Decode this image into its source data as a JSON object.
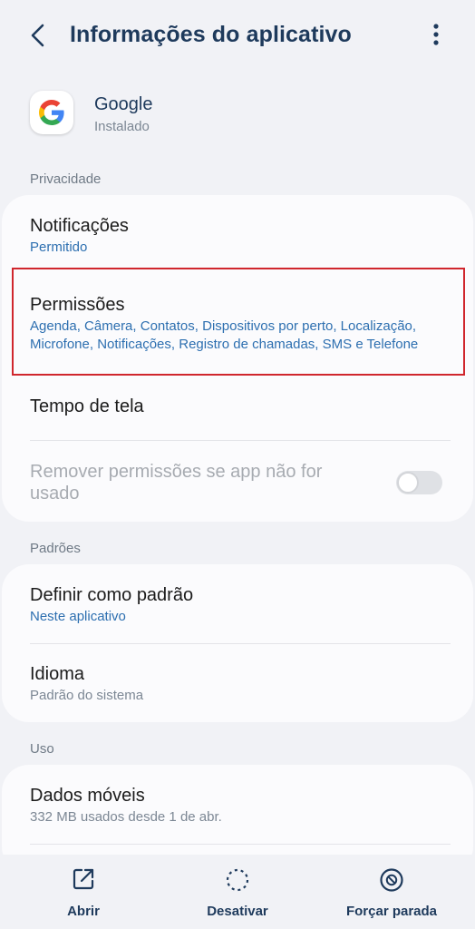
{
  "header": {
    "title": "Informações do aplicativo"
  },
  "app": {
    "name": "Google",
    "status": "Instalado"
  },
  "sections": {
    "privacy": "Privacidade",
    "defaults": "Padrões",
    "usage": "Uso"
  },
  "privacy_card": {
    "notifications": {
      "title": "Notificações",
      "value": "Permitido"
    },
    "permissions": {
      "title": "Permissões",
      "value_line1": "Agenda, Câmera, Contatos, Dispositivos por perto, Localização,",
      "value_line2": "Microfone, Notificações, Registro de chamadas, SMS e Telefone"
    },
    "screen_time": {
      "title": "Tempo de tela"
    },
    "remove_permissions": {
      "title_line1": "Remover permissões se app não for",
      "title_line2": "usado",
      "enabled": false
    }
  },
  "defaults_card": {
    "set_default": {
      "title": "Definir como padrão",
      "value": "Neste aplicativo"
    },
    "language": {
      "title": "Idioma",
      "value": "Padrão do sistema"
    }
  },
  "usage_card": {
    "mobile_data": {
      "title": "Dados móveis",
      "value": "332 MB usados desde 1 de abr."
    }
  },
  "bottom_bar": {
    "open": "Abrir",
    "disable": "Desativar",
    "force_stop": "Forçar parada"
  },
  "colors": {
    "accent": "#2d6fb0",
    "title": "#1e3a5c",
    "highlight": "#d0262d",
    "background": "#f1f2f6"
  }
}
